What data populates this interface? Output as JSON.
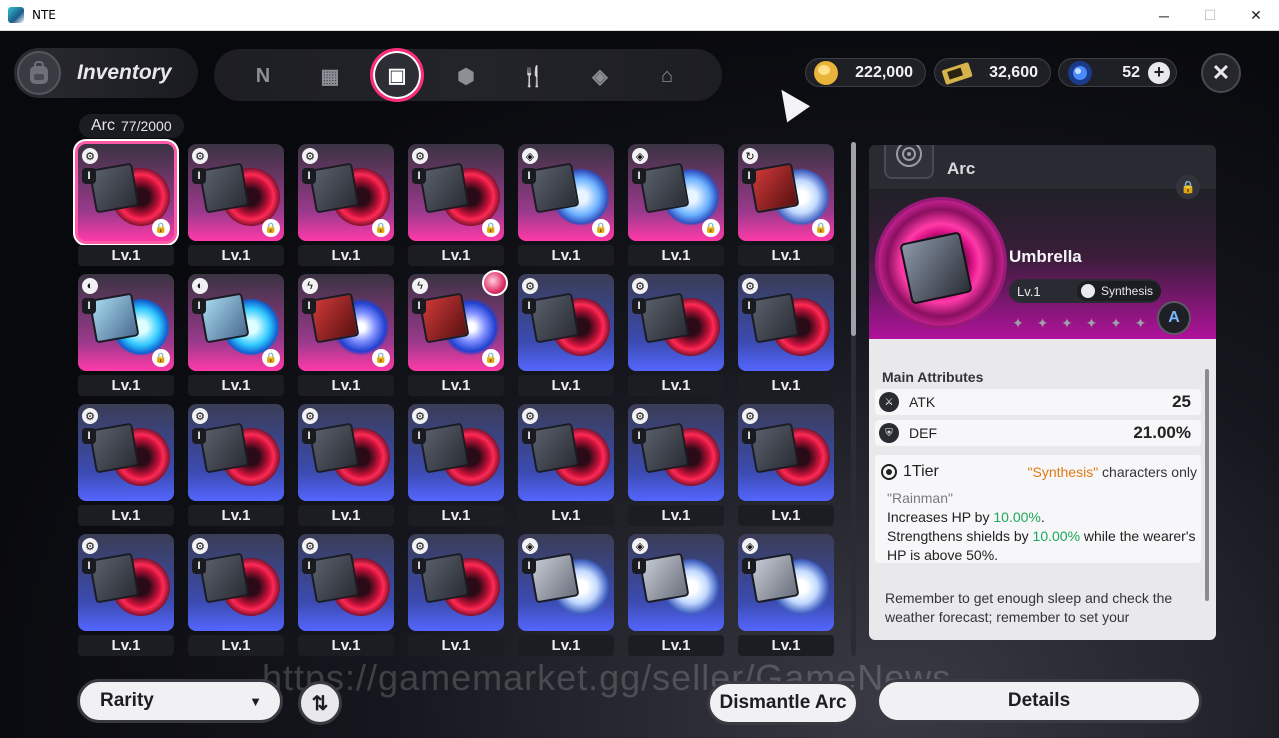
{
  "window": {
    "title": "NTE",
    "minimize": "─",
    "maximize": "☐",
    "close": "✕"
  },
  "header": {
    "title": "Inventory",
    "close_label": "✕",
    "categories": [
      {
        "name": "cat-arc-glyph",
        "icon": "N"
      },
      {
        "name": "cat-device",
        "icon": "▦"
      },
      {
        "name": "cat-arc",
        "icon": "▣",
        "active": true
      },
      {
        "name": "cat-box",
        "icon": "⬢"
      },
      {
        "name": "cat-food",
        "icon": "🍴"
      },
      {
        "name": "cat-material",
        "icon": "◈"
      },
      {
        "name": "cat-home",
        "icon": "⌂"
      }
    ],
    "currencies": [
      {
        "name": "gold-coin",
        "value": "222,000",
        "color": "#e8b43a"
      },
      {
        "name": "ticket",
        "value": "32,600",
        "color": "#d4b44a"
      },
      {
        "name": "orb",
        "value": "52",
        "color": "#4a8aff",
        "plus": "+"
      }
    ]
  },
  "list": {
    "category": "Arc",
    "count": "77/2000",
    "items": [
      {
        "level": "Lv.1",
        "rarity": "pink",
        "disc": "red",
        "cover": "",
        "badge": "⚙",
        "locked": true,
        "selected": true
      },
      {
        "level": "Lv.1",
        "rarity": "pink",
        "disc": "red",
        "cover": "",
        "badge": "⚙",
        "locked": true
      },
      {
        "level": "Lv.1",
        "rarity": "pink",
        "disc": "red",
        "cover": "",
        "badge": "⚙",
        "locked": true
      },
      {
        "level": "Lv.1",
        "rarity": "pink",
        "disc": "red",
        "cover": "",
        "badge": "⚙",
        "locked": true
      },
      {
        "level": "Lv.1",
        "rarity": "pink",
        "disc": "ice",
        "cover": "",
        "badge": "◈",
        "locked": true
      },
      {
        "level": "Lv.1",
        "rarity": "pink",
        "disc": "ice",
        "cover": "",
        "badge": "◈",
        "locked": true
      },
      {
        "level": "Lv.1",
        "rarity": "pink",
        "disc": "white",
        "cover": "red",
        "badge": "↻",
        "locked": true
      },
      {
        "level": "Lv.1",
        "rarity": "pink",
        "disc": "cyan",
        "cover": "ice",
        "badge": "◐",
        "locked": true
      },
      {
        "level": "Lv.1",
        "rarity": "pink",
        "disc": "cyan",
        "cover": "ice",
        "badge": "◐",
        "locked": true
      },
      {
        "level": "Lv.1",
        "rarity": "pink",
        "disc": "storm",
        "cover": "red",
        "badge": "ϟ",
        "locked": true
      },
      {
        "level": "Lv.1",
        "rarity": "pink",
        "disc": "storm",
        "cover": "red",
        "badge": "ϟ",
        "locked": true,
        "equipped": true
      },
      {
        "level": "Lv.1",
        "rarity": "blue",
        "disc": "red",
        "cover": "",
        "badge": "⚙",
        "locked": false
      },
      {
        "level": "Lv.1",
        "rarity": "blue",
        "disc": "red",
        "cover": "",
        "badge": "⚙",
        "locked": false
      },
      {
        "level": "Lv.1",
        "rarity": "blue",
        "disc": "red",
        "cover": "",
        "badge": "⚙",
        "locked": false
      },
      {
        "level": "Lv.1",
        "rarity": "blue",
        "disc": "red",
        "cover": "",
        "badge": "⚙",
        "locked": false
      },
      {
        "level": "Lv.1",
        "rarity": "blue",
        "disc": "red",
        "cover": "",
        "badge": "⚙",
        "locked": false
      },
      {
        "level": "Lv.1",
        "rarity": "blue",
        "disc": "red",
        "cover": "",
        "badge": "⚙",
        "locked": false
      },
      {
        "level": "Lv.1",
        "rarity": "blue",
        "disc": "red",
        "cover": "",
        "badge": "⚙",
        "locked": false
      },
      {
        "level": "Lv.1",
        "rarity": "blue",
        "disc": "red",
        "cover": "",
        "badge": "⚙",
        "locked": false
      },
      {
        "level": "Lv.1",
        "rarity": "blue",
        "disc": "red",
        "cover": "",
        "badge": "⚙",
        "locked": false
      },
      {
        "level": "Lv.1",
        "rarity": "blue",
        "disc": "red",
        "cover": "",
        "badge": "⚙",
        "locked": false
      },
      {
        "level": "Lv.1",
        "rarity": "blue",
        "disc": "red",
        "cover": "",
        "badge": "⚙",
        "locked": false
      },
      {
        "level": "Lv.1",
        "rarity": "blue",
        "disc": "red",
        "cover": "",
        "badge": "⚙",
        "locked": false
      },
      {
        "level": "Lv.1",
        "rarity": "blue",
        "disc": "red",
        "cover": "",
        "badge": "⚙",
        "locked": false
      },
      {
        "level": "Lv.1",
        "rarity": "blue",
        "disc": "red",
        "cover": "",
        "badge": "⚙",
        "locked": false
      },
      {
        "level": "Lv.1",
        "rarity": "blue",
        "disc": "white",
        "cover": "light",
        "badge": "◈",
        "locked": false
      },
      {
        "level": "Lv.1",
        "rarity": "blue",
        "disc": "white",
        "cover": "light",
        "badge": "◈",
        "locked": false
      },
      {
        "level": "Lv.1",
        "rarity": "blue",
        "disc": "white",
        "cover": "light",
        "badge": "◈",
        "locked": false
      }
    ]
  },
  "detail": {
    "category": "Arc",
    "name": "Umbrella",
    "level": "Lv.1",
    "faction": "Synthesis",
    "stars": [
      "✦",
      "✦",
      "✦",
      "✦",
      "✦",
      "✦"
    ],
    "set_badge": "A",
    "attributes_title": "Main Attributes",
    "attributes": [
      {
        "icon": "ATK-icon",
        "glyph": "⚔",
        "label": "ATK",
        "value": "25"
      },
      {
        "icon": "DEF-icon",
        "glyph": "⛨",
        "label": "DEF",
        "value": "21.00%"
      }
    ],
    "tier": "1Tier",
    "tier_restriction_quote": "\"Synthesis\"",
    "tier_restriction_rest": " characters only",
    "effect_name": "\"Rainman\"",
    "effect_line1_pre": "Increases HP by ",
    "effect_line1_val": "10.00%",
    "effect_line1_post": ".",
    "effect_line2_pre": "Strengthens shields by ",
    "effect_line2_val": "10.00%",
    "effect_line2_post": " while the wearer's HP is above 50%.",
    "flavor": "Remember to get enough sleep and check the weather forecast; remember to set your"
  },
  "footer": {
    "rarity_label": "Rarity",
    "rarity_caret": "▼",
    "sort_icon": "⇅",
    "dismantle_label": "Dismantle Arc",
    "details_label": "Details"
  },
  "watermark": "https://gamemarket.gg/seller/GameNews",
  "colors": {
    "accent_pink": "#ff2d7a",
    "highlight_green": "#1aa85a",
    "highlight_orange": "#e07a14"
  }
}
